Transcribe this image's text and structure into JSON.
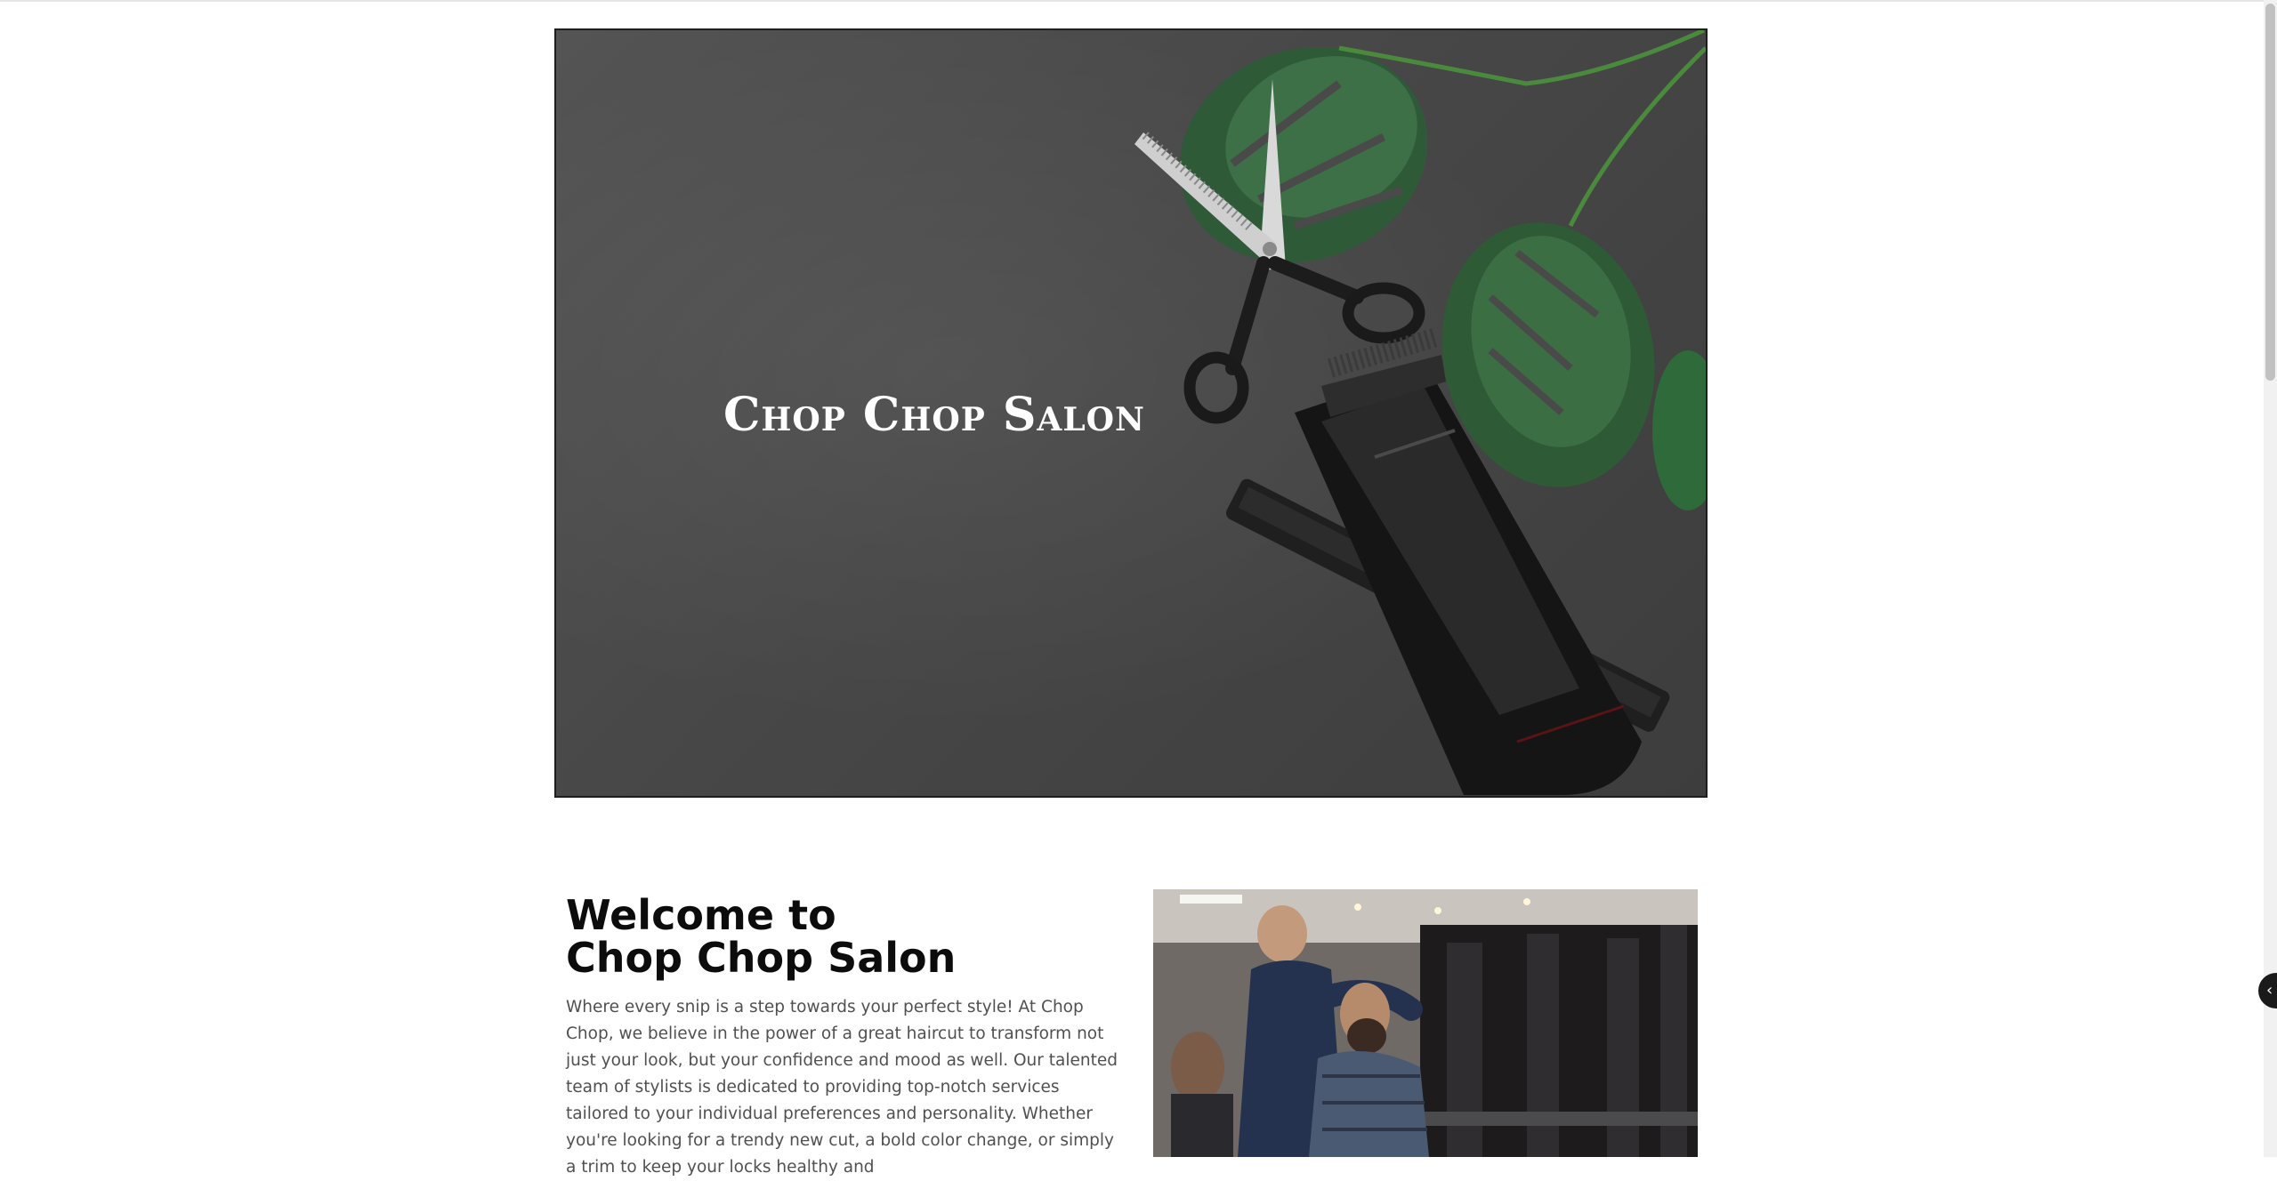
{
  "hero": {
    "title": "Chop Chop Salon"
  },
  "welcome": {
    "heading_line1": "Welcome to",
    "heading_line2": "Chop Chop Salon",
    "body": "Where every snip is a step towards your perfect style! At Chop Chop, we believe in the power of a great haircut to transform not just your look, but your confidence and mood as well. Our talented team of stylists is dedicated to providing top-notch services tailored to your individual preferences and personality. Whether you're looking for a trendy new cut, a bold color change, or simply a trim to keep your locks healthy and"
  },
  "widget": {
    "icon": "chevron-left-icon",
    "glyph": "‹"
  },
  "colors": {
    "hero_background": "#4a4a4a",
    "heading_text": "#0c0c0c",
    "body_text": "#505050"
  }
}
